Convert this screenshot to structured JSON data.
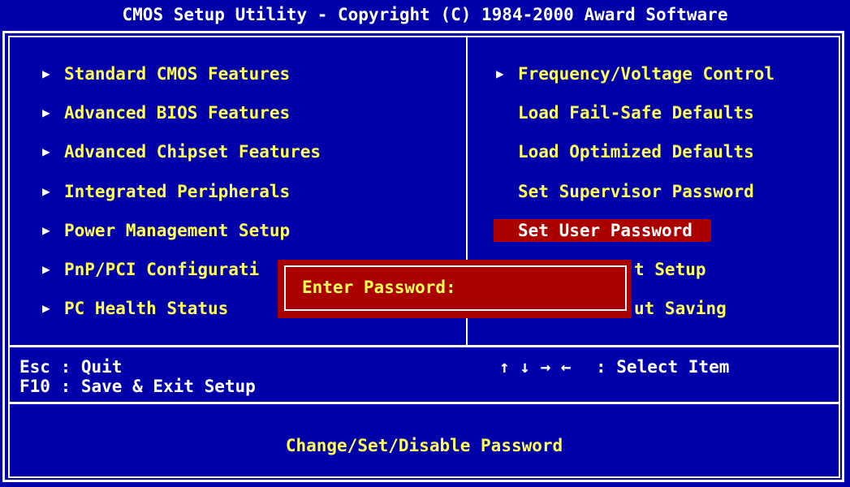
{
  "title": "CMOS Setup Utility - Copyright (C) 1984-2000 Award Software",
  "menu_left": [
    {
      "label": "Standard CMOS Features"
    },
    {
      "label": "Advanced BIOS Features"
    },
    {
      "label": "Advanced Chipset Features"
    },
    {
      "label": "Integrated Peripherals"
    },
    {
      "label": "Power Management Setup"
    },
    {
      "label": "PnP/PCI Configurati"
    },
    {
      "label": "PC Health Status"
    }
  ],
  "menu_right": [
    {
      "label": "Frequency/Voltage Control"
    },
    {
      "label": "Load Fail-Safe Defaults"
    },
    {
      "label": "Load Optimized Defaults"
    },
    {
      "label": "Set Supervisor Password"
    },
    {
      "label": "Set User Password"
    },
    {
      "label": "t Setup"
    },
    {
      "label": "ut Saving"
    }
  ],
  "dialog": {
    "label": "Enter Password:",
    "value": ""
  },
  "help": {
    "esc": "Esc : Quit",
    "f10": "F10 : Save & Exit Setup",
    "arrows": "↑ ↓ → ←",
    "select": ": Select Item"
  },
  "status": "Change/Set/Disable Password",
  "colors": {
    "background": "#0000aa",
    "text": "#ffff55",
    "highlight": "#aa0000",
    "border": "#ffffff"
  }
}
